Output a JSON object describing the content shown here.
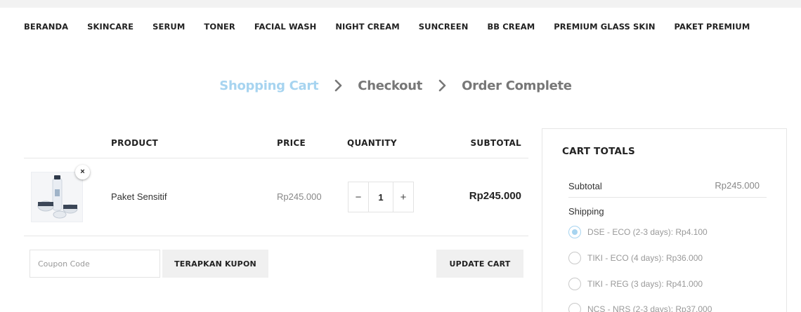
{
  "nav": [
    "BERANDA",
    "SKINCARE",
    "SERUM",
    "TONER",
    "FACIAL WASH",
    "NIGHT CREAM",
    "SUNCREEN",
    "BB CREAM",
    "PREMIUM GLASS SKIN",
    "PAKET PREMIUM"
  ],
  "steps": {
    "cart": "Shopping Cart",
    "checkout": "Checkout",
    "complete": "Order Complete",
    "active_color": "#a7d4f0",
    "inactive_color": "#777777"
  },
  "table": {
    "headers": {
      "product": "PRODUCT",
      "price": "PRICE",
      "quantity": "QUANTITY",
      "subtotal": "SUBTOTAL"
    },
    "row": {
      "remove": "×",
      "name": "Paket Sensitif",
      "price": "Rp245.000",
      "qty_minus": "−",
      "qty": "1",
      "qty_plus": "+",
      "subtotal": "Rp245.000"
    }
  },
  "coupon": {
    "placeholder": "Coupon Code",
    "apply_label": "TERAPKAN KUPON",
    "update_label": "UPDATE CART"
  },
  "totals": {
    "title": "CART TOTALS",
    "subtotal_label": "Subtotal",
    "subtotal_value": "Rp245.000",
    "shipping_label": "Shipping",
    "options": [
      {
        "label": "DSE - ECO (2-3 days): Rp4.100",
        "selected": true
      },
      {
        "label": "TIKI - ECO (4 days): Rp36.000",
        "selected": false
      },
      {
        "label": "TIKI - REG (3 days): Rp41.000",
        "selected": false
      },
      {
        "label": "NCS - NRS (2-3 days): Rp37.000",
        "selected": false
      }
    ]
  }
}
